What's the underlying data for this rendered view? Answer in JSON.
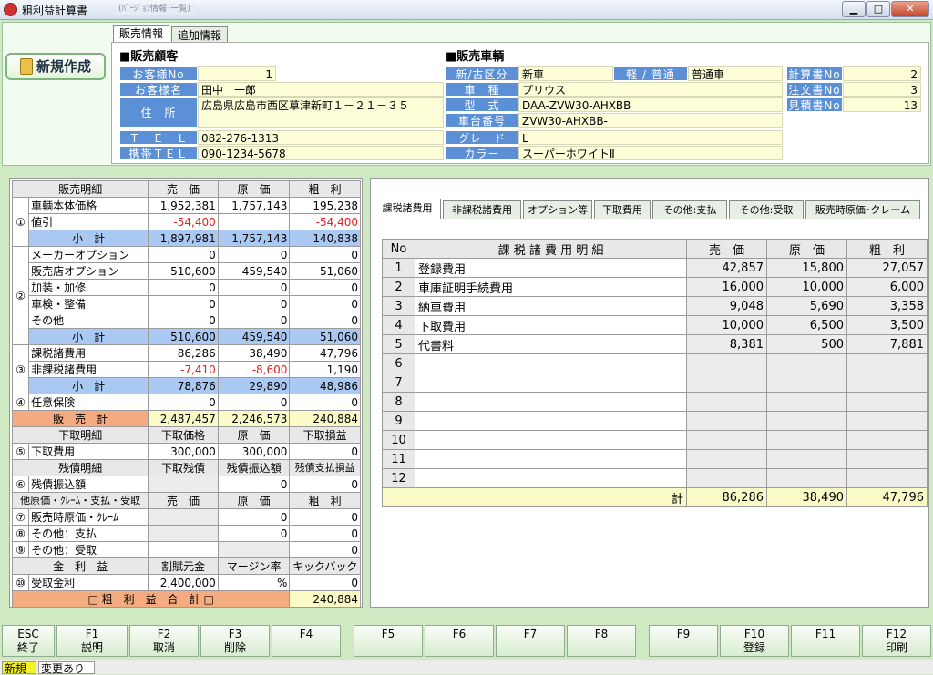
{
  "window": {
    "title": "粗利益計算書",
    "address": "(ﾊﾞｰｼﾞｮﾝ情報･一覧)",
    "min_glyph": "▁",
    "max_glyph": "□",
    "close_glyph": "✕"
  },
  "new_button": "新規作成",
  "tabs_top": [
    "販売情報",
    "追加情報"
  ],
  "customer": {
    "section": "■販売顧客",
    "no_label": "お客様No",
    "no": "1",
    "name_label": "お客様名",
    "name": "田中　一郎",
    "address_label": "住　所",
    "address": "広島県広島市西区草津新町１－２１－３５",
    "tel_label": "Ｔ　Ｅ　Ｌ",
    "tel": "082-276-1313",
    "mobile_label": "携帯ＴＥＬ",
    "mobile": "090-1234-5678"
  },
  "vehicle": {
    "section": "■販売車輌",
    "newused_label": "新/古区分",
    "newused": "新車",
    "kei_label": "軽 / 普通",
    "kei": "普通車",
    "model_label": "車　種",
    "model": "プリウス",
    "type_label": "型　式",
    "type": "DAA-ZVW30-AHXBB",
    "chassis_label": "車台番号",
    "chassis": "ZVW30-AHXBB-",
    "grade_label": "グレード",
    "grade": "L",
    "color_label": "カラー",
    "color": "スーパーホワイトⅡ"
  },
  "docs": [
    {
      "label": "計算書No",
      "value": "2"
    },
    {
      "label": "注文書No",
      "value": "3"
    },
    {
      "label": "見積書No",
      "value": "13"
    }
  ],
  "left_table": {
    "header": [
      "販売明細",
      "売　価",
      "原　価",
      "粗　利"
    ],
    "g1": {
      "mark": "①",
      "rows": [
        [
          "車輌本体価格",
          "1,952,381",
          "1,757,143",
          "195,238"
        ],
        [
          "値引",
          "-54,400",
          "",
          "-54,400"
        ]
      ],
      "subtotal": [
        "小　計",
        "1,897,981",
        "1,757,143",
        "140,838"
      ]
    },
    "g2": {
      "mark": "②",
      "rows": [
        [
          "メーカーオプション",
          "0",
          "0",
          "0"
        ],
        [
          "販売店オプション",
          "510,600",
          "459,540",
          "51,060"
        ],
        [
          "加装・加修",
          "0",
          "0",
          "0"
        ],
        [
          "車検・整備",
          "0",
          "0",
          "0"
        ],
        [
          "その他",
          "0",
          "0",
          "0"
        ]
      ],
      "subtotal": [
        "小　計",
        "510,600",
        "459,540",
        "51,060"
      ]
    },
    "g3": {
      "mark": "③",
      "rows": [
        [
          "課税諸費用",
          "86,286",
          "38,490",
          "47,796"
        ],
        [
          "非課税諸費用",
          "-7,410",
          "-8,600",
          "1,190"
        ]
      ],
      "subtotal": [
        "小　計",
        "78,876",
        "29,890",
        "48,986"
      ]
    },
    "g4": {
      "mark": "④",
      "row": [
        "任意保険",
        "0",
        "0",
        "0"
      ]
    },
    "sales_total": [
      "販　売　計",
      "2,487,457",
      "2,246,573",
      "240,884"
    ],
    "trade_header": [
      "下取明細",
      "下取価格",
      "原　価",
      "下取損益"
    ],
    "g5": {
      "mark": "⑤",
      "row": [
        "下取費用",
        "300,000",
        "300,000",
        "0"
      ]
    },
    "debt_header": [
      "残債明細",
      "下取残債",
      "残債振込額",
      "残債支払損益"
    ],
    "g6": {
      "mark": "⑥",
      "row": [
        "残債振込額",
        "",
        "0",
        "0"
      ]
    },
    "other_header": [
      "他原価・ｸﾚｰﾑ・支払・受取",
      "売　価",
      "原　価",
      "粗　利"
    ],
    "g7": {
      "mark": "⑦",
      "row": [
        "販売時原価・ｸﾚｰﾑ",
        "",
        "0",
        "0"
      ]
    },
    "g8": {
      "mark": "⑧",
      "row": [
        "その他：支払",
        "",
        "0",
        "0"
      ]
    },
    "g9": {
      "mark": "⑨",
      "row": [
        "その他：受取",
        "",
        "",
        "0"
      ]
    },
    "interest_header": [
      "金　利　益",
      "割賦元金",
      "マージン率",
      "キックバック"
    ],
    "g10": {
      "mark": "⑩",
      "row": [
        "受取金利",
        "2,400,000",
        "%",
        "0"
      ]
    },
    "grand_total": [
      "□ 粗　利　益　合　計 □",
      "240,884"
    ]
  },
  "right_tabs": [
    "課税諸費用",
    "非課税諸費用",
    "オプション等",
    "下取費用",
    "その他:支払",
    "その他:受取",
    "販売時原価･クレーム"
  ],
  "right_table": {
    "header": [
      "No",
      "課 税 諸 費 用 明 細",
      "売　価",
      "原　価",
      "粗　利"
    ],
    "rows": [
      [
        "1",
        "登録費用",
        "42,857",
        "15,800",
        "27,057"
      ],
      [
        "2",
        "車庫証明手続費用",
        "16,000",
        "10,000",
        "6,000"
      ],
      [
        "3",
        "納車費用",
        "9,048",
        "5,690",
        "3,358"
      ],
      [
        "4",
        "下取費用",
        "10,000",
        "6,500",
        "3,500"
      ],
      [
        "5",
        "代書料",
        "8,381",
        "500",
        "7,881"
      ],
      [
        "6",
        "",
        "",
        "",
        ""
      ],
      [
        "7",
        "",
        "",
        "",
        ""
      ],
      [
        "8",
        "",
        "",
        "",
        ""
      ],
      [
        "9",
        "",
        "",
        "",
        ""
      ],
      [
        "10",
        "",
        "",
        "",
        ""
      ],
      [
        "11",
        "",
        "",
        "",
        ""
      ],
      [
        "12",
        "",
        "",
        "",
        ""
      ]
    ],
    "total": [
      "計",
      "86,286",
      "38,490",
      "47,796"
    ]
  },
  "fkeys": [
    [
      "ESC",
      "終了"
    ],
    [
      "F1",
      "説明"
    ],
    [
      "F2",
      "取消"
    ],
    [
      "F3",
      "削除"
    ],
    [
      "F4",
      ""
    ],
    [
      "F5",
      ""
    ],
    [
      "F6",
      ""
    ],
    [
      "F7",
      ""
    ],
    [
      "F8",
      ""
    ],
    [
      "F9",
      ""
    ],
    [
      "F10",
      "登録"
    ],
    [
      "F11",
      ""
    ],
    [
      "F12",
      "印刷"
    ]
  ],
  "status": [
    "新規",
    "変更あり"
  ]
}
